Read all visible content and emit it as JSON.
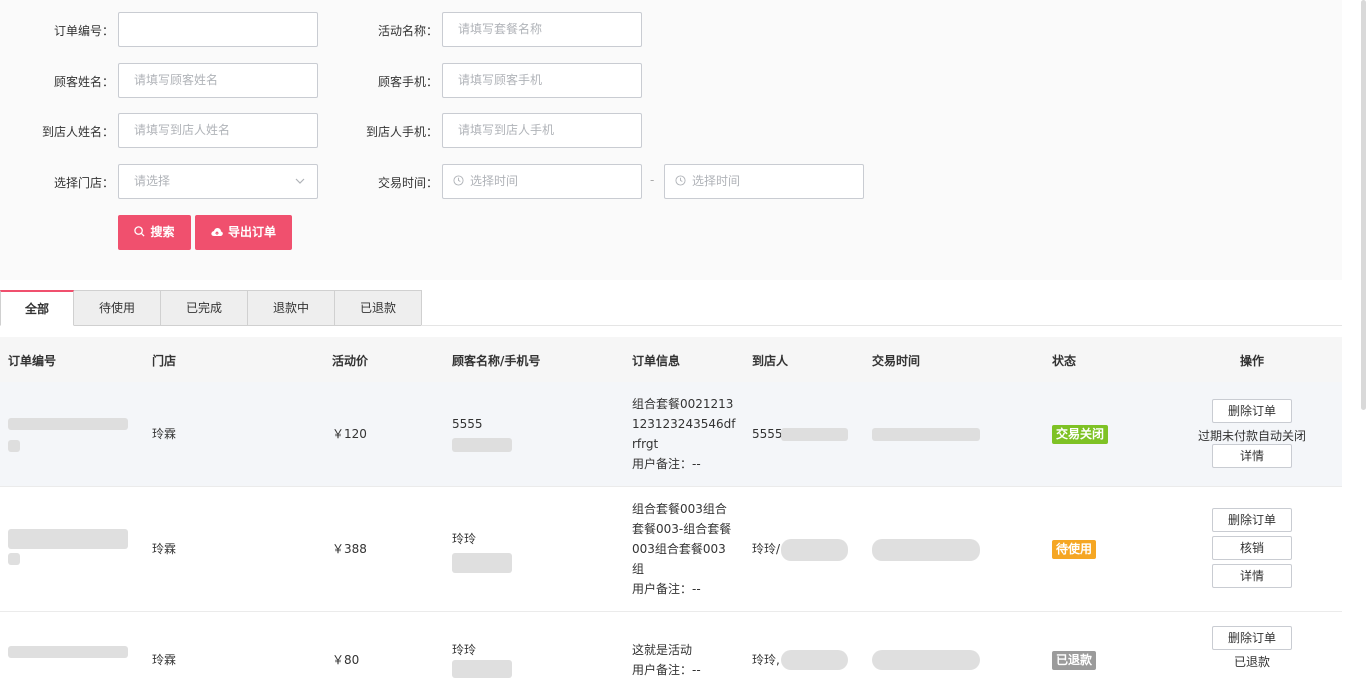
{
  "filters": {
    "order_no": {
      "label": "订单编号：",
      "value": "",
      "placeholder": ""
    },
    "activity_name": {
      "label": "活动名称：",
      "placeholder": "请填写套餐名称"
    },
    "customer_name": {
      "label": "顾客姓名：",
      "placeholder": "请填写顾客姓名"
    },
    "customer_phone": {
      "label": "顾客手机：",
      "placeholder": "请填写顾客手机"
    },
    "visitor_name": {
      "label": "到店人姓名：",
      "placeholder": "请填写到店人姓名"
    },
    "visitor_phone": {
      "label": "到店人手机：",
      "placeholder": "请填写到店人手机"
    },
    "store": {
      "label": "选择门店：",
      "selected": "请选择"
    },
    "trade_time": {
      "label": "交易时间：",
      "start_placeholder": "选择时间",
      "separator": "-",
      "end_placeholder": "选择时间"
    }
  },
  "buttons": {
    "search": "搜索",
    "export": "导出订单"
  },
  "tabs": [
    "全部",
    "待使用",
    "已完成",
    "退款中",
    "已退款"
  ],
  "table": {
    "columns": [
      "订单编号",
      "门店",
      "活动价",
      "顾客名称/手机号",
      "订单信息",
      "到店人",
      "交易时间",
      "状态",
      "操作"
    ],
    "rows": [
      {
        "store": "玲霖",
        "price": "￥120",
        "customer_name": "5555",
        "order_info": [
          "组合套餐0021213",
          "123123243546df",
          "rfrgt"
        ],
        "remark": "用户备注：--",
        "visitor": "5555",
        "status": "交易关闭",
        "status_color": "#7ec225",
        "actions": {
          "delete": "删除订单",
          "note": "过期未付款自动关闭",
          "detail": "详情"
        }
      },
      {
        "store": "玲霖",
        "price": "￥388",
        "customer_name": "玲玲",
        "order_info": [
          "组合套餐003组合",
          "套餐003-组合套餐",
          "003组合套餐003",
          "组"
        ],
        "remark": "用户备注：--",
        "visitor": "玲玲/",
        "status": "待使用",
        "status_color": "#f5a623",
        "actions": {
          "delete": "删除订单",
          "verify": "核销",
          "detail": "详情"
        }
      },
      {
        "store": "玲霖",
        "price": "￥80",
        "customer_name": "玲玲",
        "order_info": [
          "这就是活动"
        ],
        "remark": "用户备注：--",
        "visitor": "玲玲,",
        "status": "已退款",
        "status_color": "#9b9b9b",
        "actions": {
          "delete": "删除订单",
          "note": "已退款"
        }
      }
    ]
  },
  "colors": {
    "accent": "#f0506e",
    "border": "#c9ccd2",
    "panel_bg": "#fafafa"
  }
}
